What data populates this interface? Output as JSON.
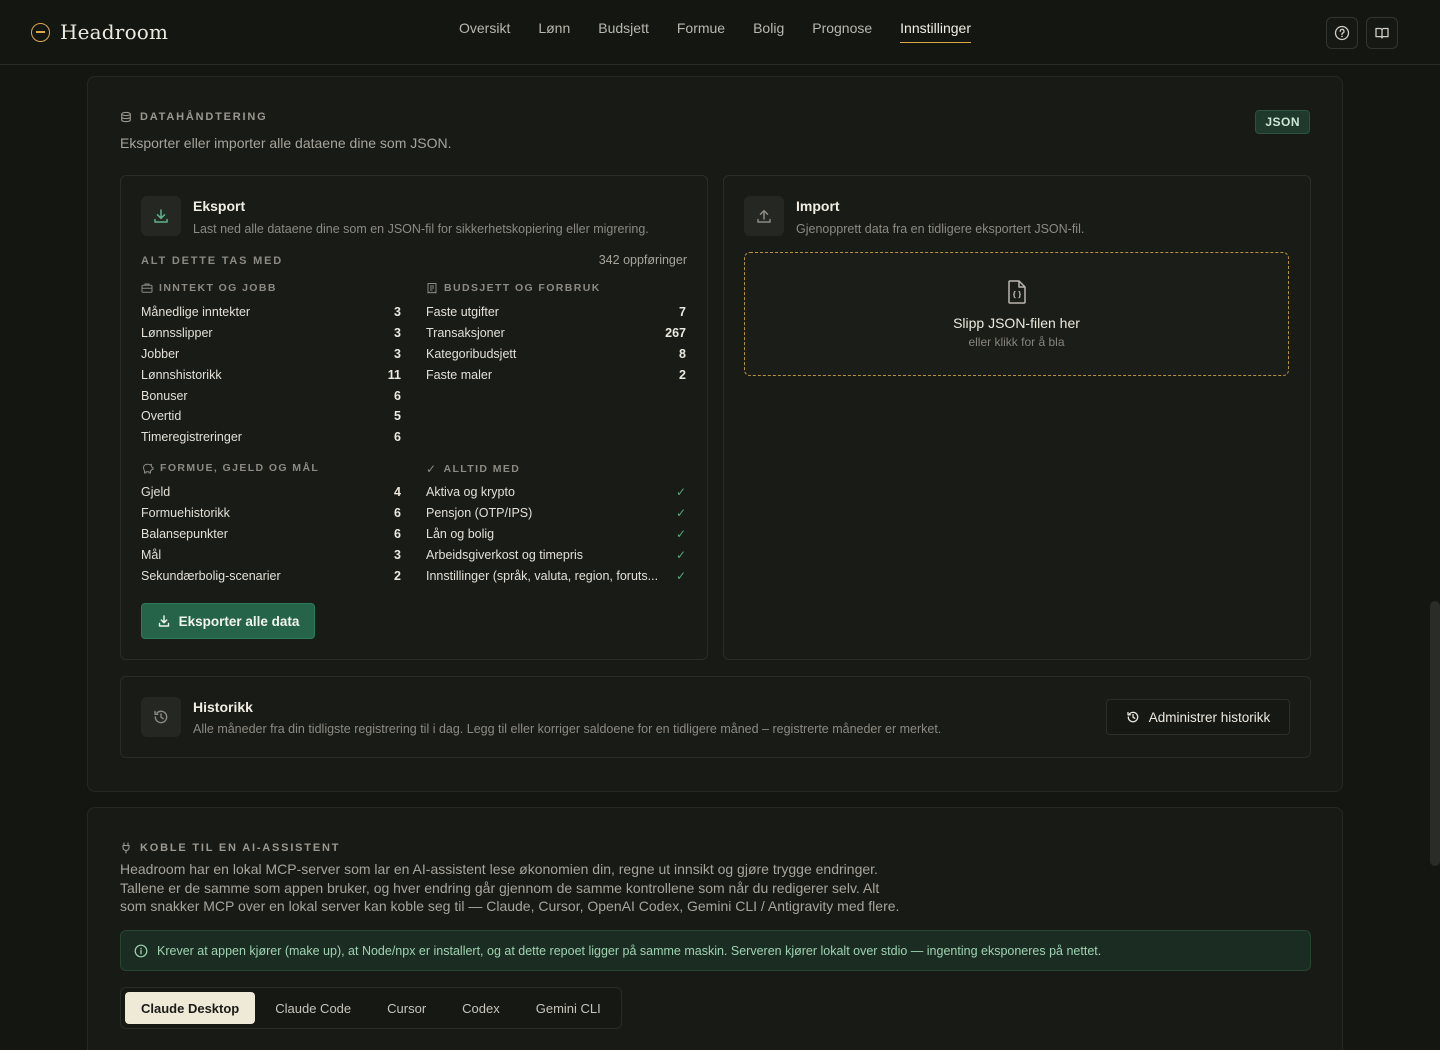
{
  "brand": {
    "name": "Headroom"
  },
  "nav": [
    "Oversikt",
    "Lønn",
    "Budsjett",
    "Formue",
    "Bolig",
    "Prognose",
    "Innstillinger"
  ],
  "nav_active": "Innstillinger",
  "data_section": {
    "kicker": "Datahåndtering",
    "description": "Eksporter eller importer alle dataene dine som JSON.",
    "badge": "JSON",
    "export": {
      "title": "Eksport",
      "subtitle": "Last ned alle dataene dine som en JSON-fil for sikkerhetskopiering eller migrering.",
      "included_label": "Alt dette tas med",
      "count_label": "342 oppføringer",
      "groups": {
        "income": {
          "title": "Inntekt og jobb",
          "rows": [
            {
              "label": "Månedlige inntekter",
              "value": "3"
            },
            {
              "label": "Lønnsslipper",
              "value": "3"
            },
            {
              "label": "Jobber",
              "value": "3"
            },
            {
              "label": "Lønnshistorikk",
              "value": "11"
            },
            {
              "label": "Bonuser",
              "value": "6"
            },
            {
              "label": "Overtid",
              "value": "5"
            },
            {
              "label": "Timeregistreringer",
              "value": "6"
            }
          ]
        },
        "budget": {
          "title": "Budsjett og forbruk",
          "rows": [
            {
              "label": "Faste utgifter",
              "value": "7"
            },
            {
              "label": "Transaksjoner",
              "value": "267"
            },
            {
              "label": "Kategoribudsjett",
              "value": "8"
            },
            {
              "label": "Faste maler",
              "value": "2"
            }
          ]
        },
        "wealth": {
          "title": "Formue, gjeld og mål",
          "rows": [
            {
              "label": "Gjeld",
              "value": "4"
            },
            {
              "label": "Formuehistorikk",
              "value": "6"
            },
            {
              "label": "Balansepunkter",
              "value": "6"
            },
            {
              "label": "Mål",
              "value": "3"
            },
            {
              "label": "Sekundærbolig-scenarier",
              "value": "2"
            }
          ]
        },
        "always": {
          "title": "Alltid med",
          "rows": [
            {
              "label": "Aktiva og krypto"
            },
            {
              "label": "Pensjon (OTP/IPS)"
            },
            {
              "label": "Lån og bolig"
            },
            {
              "label": "Arbeidsgiverkost og timepris"
            },
            {
              "label": "Innstillinger (språk, valuta, region, foruts..."
            }
          ]
        }
      },
      "button": "Eksporter alle data"
    },
    "import": {
      "title": "Import",
      "subtitle": "Gjenopprett data fra en tidligere eksportert JSON-fil.",
      "drop_title": "Slipp JSON-filen her",
      "drop_sub": "eller klikk for å bla"
    },
    "history": {
      "title": "Historikk",
      "subtitle": "Alle måneder fra din tidligste registrering til i dag. Legg til eller korriger saldoene for en tidligere måned – registrerte måneder er merket.",
      "button": "Administrer historikk"
    }
  },
  "ai_section": {
    "kicker": "Koble til en AI-assistent",
    "description_lines": [
      "Headroom har en lokal MCP-server som lar en AI-assistent lese økonomien din, regne ut innsikt og gjøre trygge endringer.",
      "Tallene er de samme som appen bruker, og hver endring går gjennom de samme kontrollene som når du redigerer selv. Alt",
      "som snakker MCP over en lokal server kan koble seg til — Claude, Cursor, OpenAI Codex, Gemini CLI / Antigravity med flere."
    ],
    "notice": "Krever at appen kjører (make up), at Node/npx er installert, og at dette repoet ligger på samme maskin. Serveren kjører lokalt over stdio — ingenting eksponeres på nettet.",
    "tabs": [
      "Claude Desktop",
      "Claude Code",
      "Cursor",
      "Codex",
      "Gemini CLI"
    ],
    "active_tab": "Claude Desktop"
  }
}
